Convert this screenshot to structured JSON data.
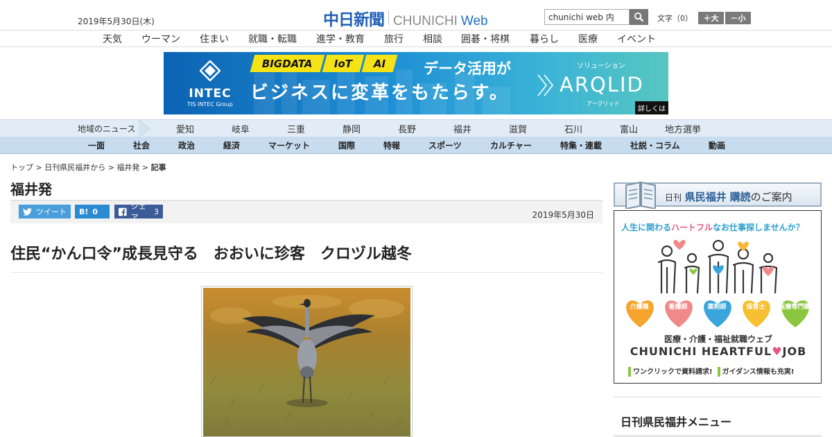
{
  "header": {
    "date": "2019年5月30日(木)",
    "logo_kanji": "中日新聞",
    "logo_latin": "CHUNICHI",
    "logo_web": "Web",
    "search_value": "chunichi web 内",
    "text_size_label": "文字（0）",
    "text_larger": "＋大",
    "text_smaller": "－小"
  },
  "category_nav": [
    "天気",
    "ウーマン",
    "住まい",
    "就職・転職",
    "進学・教育",
    "旅行",
    "相談",
    "囲碁・将棋",
    "暮らし",
    "医療",
    "イベント"
  ],
  "banner": {
    "company": "INTEC",
    "company_sub": "TIS INTEC Group",
    "tags": [
      "BIGDATA",
      "IoT",
      "AI"
    ],
    "line1": "データ活用が",
    "line2": "ビジネスに変革をもたらす。",
    "solution_label": "ソリューション",
    "product": "ARQLID",
    "product_kana": "アークリッド",
    "detail_label": "詳しくは"
  },
  "region_nav": {
    "title": "地域のニュース",
    "items": [
      "愛知",
      "岐阜",
      "三重",
      "静岡",
      "長野",
      "福井",
      "滋賀",
      "石川",
      "富山",
      "地方選挙"
    ]
  },
  "section_nav": [
    "一面",
    "社会",
    "政治",
    "経済",
    "マーケット",
    "国際",
    "特報",
    "スポーツ",
    "カルチャー",
    "特集・連載",
    "社説・コラム",
    "動画"
  ],
  "breadcrumb": {
    "items": [
      "トップ",
      "日刊県民福井から",
      "福井発"
    ],
    "current": "記事",
    "sep": " > "
  },
  "section_title": "福井発",
  "share": {
    "tweet_label": "ツイート",
    "hatena_icon": "B!",
    "hatena_count": "0",
    "facebook_label": "シェア",
    "facebook_count": "3"
  },
  "article": {
    "date": "2019年5月30日",
    "headline": "住民“かん口令”成長見守る　おおいに珍客　クロヅル越冬"
  },
  "sidebar": {
    "subscribe_prefix": "日刊",
    "subscribe_name": "県民福井",
    "subscribe_action": "購読",
    "subscribe_suffix": "のご案内",
    "ad": {
      "headline_a": "人生に関わる",
      "headline_b": "ハートフル",
      "headline_c": "なお仕事探しませんか？",
      "jobs": [
        "介護職",
        "看護師",
        "薬剤師",
        "保育士",
        "医療専門職"
      ],
      "subtitle": "医療・介護・福祉就職ウェブ",
      "brand_a": "CHUNICHI HEARTFUL",
      "brand_b": "JOB",
      "note1": "ワンクリックで資料請求!",
      "note2": "ガイダンス情報も充実!"
    },
    "menu_title": "日刊県民福井メニュー"
  },
  "colors": {
    "logo_blue": "#1f5fb5",
    "region_nav_bg": "#e2ecf6",
    "section_nav_bg": "#c8dcf0",
    "twitter": "#4a9edb",
    "hatena": "#2a8ad2",
    "facebook": "#3e5b99"
  }
}
